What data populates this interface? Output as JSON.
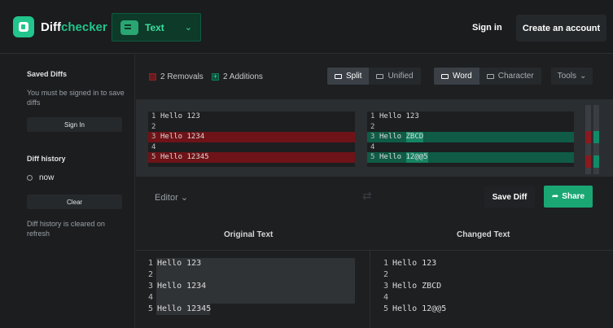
{
  "header": {
    "logo_name": "Diff",
    "logo_accent": "checker",
    "tab_label": "Text",
    "sign_in": "Sign in",
    "create_account": "Create an account"
  },
  "sidebar": {
    "saved_title": "Saved Diffs",
    "saved_msg": "You must be signed in to save diffs",
    "sign_in_btn": "Sign In",
    "history_title": "Diff history",
    "history_item": "now",
    "clear_btn": "Clear",
    "cleared_msg": "Diff history is cleared on refresh"
  },
  "toolbar": {
    "removals": "2 Removals",
    "additions": "2 Additions",
    "split": "Split",
    "unified": "Unified",
    "word": "Word",
    "character": "Character",
    "tools": "Tools"
  },
  "diff": {
    "left": [
      {
        "n": "1",
        "text": "Hello 123",
        "type": ""
      },
      {
        "n": "2",
        "text": "",
        "type": ""
      },
      {
        "n": "3",
        "text": "Hello 1234",
        "type": "del"
      },
      {
        "n": "4",
        "text": "",
        "type": ""
      },
      {
        "n": "5",
        "text": "Hello 12345",
        "type": "del"
      }
    ],
    "right": [
      {
        "n": "1",
        "text": "Hello 123",
        "type": ""
      },
      {
        "n": "2",
        "text": "",
        "type": ""
      },
      {
        "n": "3",
        "text": "Hello ",
        "hl": "ZBCD",
        "type": "add"
      },
      {
        "n": "4",
        "text": "",
        "type": ""
      },
      {
        "n": "5",
        "text": "Hello ",
        "hl": "12@@5",
        "type": "add"
      }
    ]
  },
  "editor": {
    "editor_label": "Editor",
    "save": "Save Diff",
    "share": "Share",
    "original_title": "Original Text",
    "changed_title": "Changed Text",
    "original": [
      {
        "n": "1",
        "text": "Hello 123"
      },
      {
        "n": "2",
        "text": ""
      },
      {
        "n": "3",
        "text": "Hello 1234"
      },
      {
        "n": "4",
        "text": ""
      },
      {
        "n": "5",
        "text": "Hello 12345"
      }
    ],
    "changed": [
      {
        "n": "1",
        "text": "Hello 123"
      },
      {
        "n": "2",
        "text": ""
      },
      {
        "n": "3",
        "text": "Hello ZBCD"
      },
      {
        "n": "4",
        "text": ""
      },
      {
        "n": "5",
        "text": "Hello 12@@5"
      }
    ]
  },
  "colors": {
    "accent": "#22c58b",
    "removed": "#6e1317",
    "added": "#0f5b45"
  }
}
